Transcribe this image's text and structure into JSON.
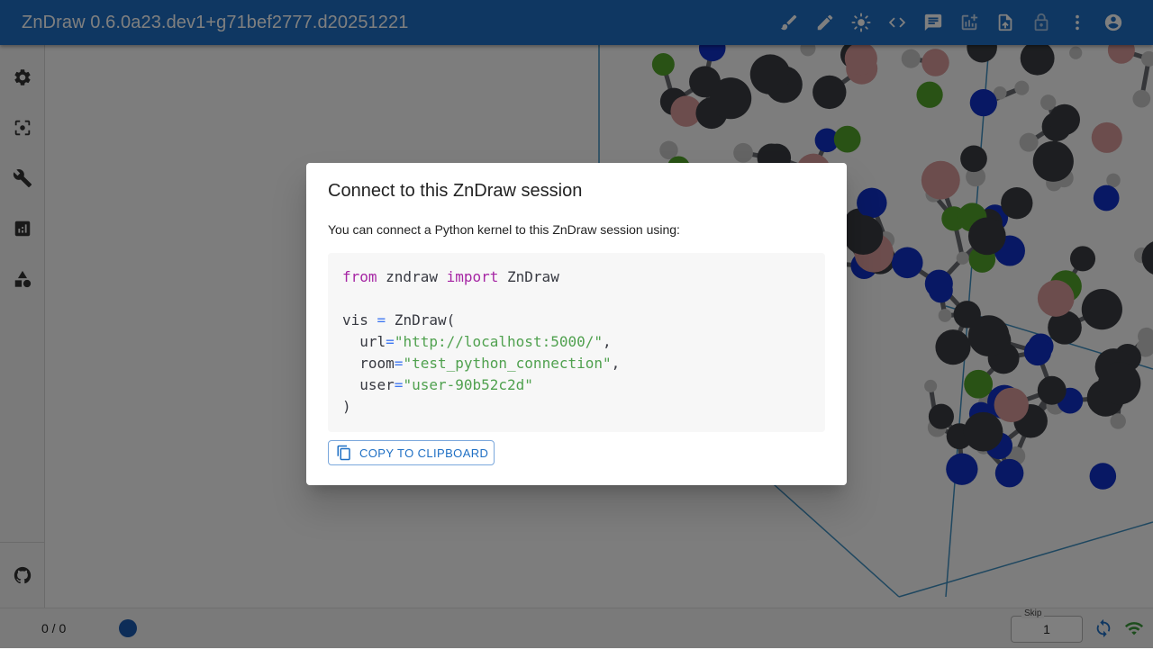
{
  "app": {
    "title": "ZnDraw 0.6.0a23.dev1+g71bef2777.d20251221"
  },
  "toolbar": {
    "icons": [
      "brush-icon",
      "pencil-icon",
      "brightness-icon",
      "code-icon",
      "chat-icon",
      "add-chart-icon",
      "upload-file-icon",
      "lock-icon",
      "more-vert-icon",
      "account-circle-icon"
    ]
  },
  "sidebar": {
    "icons": [
      "settings-icon",
      "center-focus-icon",
      "wrench-icon",
      "analytics-icon",
      "category-icon",
      "github-icon"
    ]
  },
  "bottombar": {
    "frame_counter": "0 / 0",
    "skip_label": "Skip",
    "skip_value": "1"
  },
  "dialog": {
    "title": "Connect to this ZnDraw session",
    "description": "You can connect a Python kernel to this ZnDraw session using:",
    "code": {
      "line1": {
        "kw_from": "from",
        "module": " zndraw ",
        "kw_import": "import",
        "cls": " ZnDraw"
      },
      "line3": {
        "var": "vis ",
        "eq": "=",
        "call": " ZnDraw("
      },
      "line4": {
        "key": "  url",
        "eq": "=",
        "val": "\"http://localhost:5000/\"",
        "comma": ","
      },
      "line5": {
        "key": "  room",
        "eq": "=",
        "val": "\"test_python_connection\"",
        "comma": ","
      },
      "line6": {
        "key": "  user",
        "eq": "=",
        "val": "\"user-90b52c2d\""
      },
      "line7": {
        "close": ")"
      }
    },
    "copy_button": "COPY TO CLIPBOARD"
  },
  "colors": {
    "appbar": "#1e6fc4",
    "carbon": "#3a3d42",
    "hydrogen": "#c8c8c8",
    "nitrogen": "#1030c8",
    "chlorine": "#52a52a",
    "fluorine": "#d99a9a",
    "cell": "#3f8fc0"
  }
}
